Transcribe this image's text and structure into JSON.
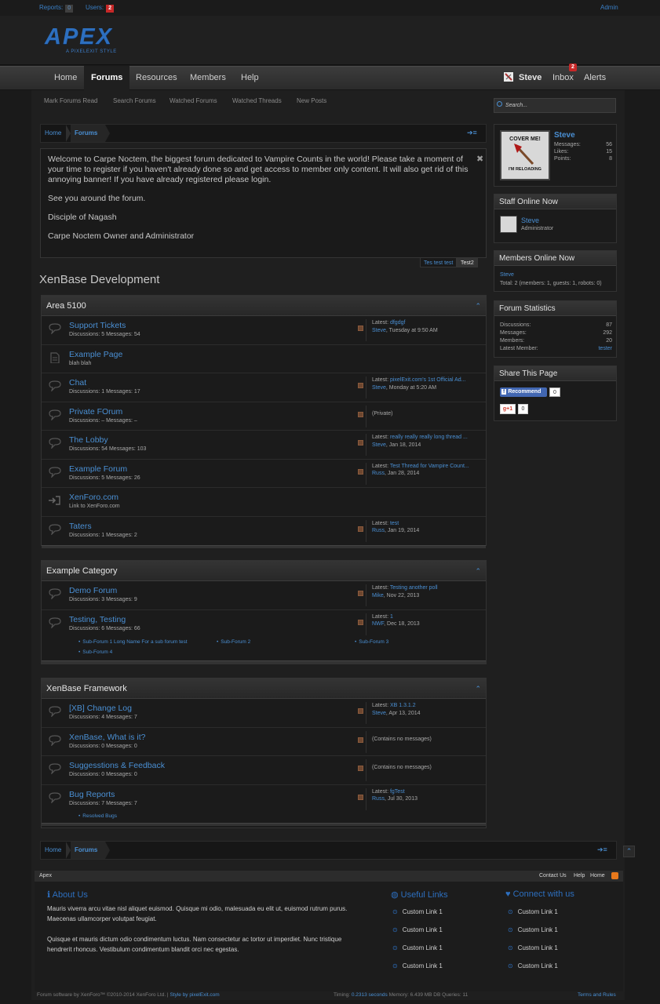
{
  "topbar": {
    "reports_label": "Reports:",
    "reports_count": "0",
    "users_label": "Users:",
    "users_count": "2",
    "admin": "Admin"
  },
  "header": {
    "logo": "APEX",
    "logo_sub": "A PIXELEXIT STYLE"
  },
  "nav": {
    "tabs": [
      "Home",
      "Forums",
      "Resources",
      "Members",
      "Help"
    ],
    "user": "Steve",
    "inbox": "Inbox",
    "inbox_count": "2",
    "alerts": "Alerts"
  },
  "subnav": [
    "Mark Forums Read",
    "Search Forums",
    "Watched Forums",
    "Watched Threads",
    "New Posts"
  ],
  "search_placeholder": "Search...",
  "breadcrumb": {
    "home": "Home",
    "current": "Forums"
  },
  "notice": {
    "p1": "Welcome to Carpe Noctem, the biggest forum dedicated to Vampire Counts in the world! Please take a moment of your time to register if you haven't already done so and get access to member only content. It will also get rid of this annoying banner! If you have already registered please login.",
    "p2": "See you around the forum.",
    "p3": "Disciple of Nagash",
    "p4": "Carpe Noctem Owner and Administrator",
    "tabs": [
      "Tes test test",
      "Test2"
    ]
  },
  "section_title": "XenBase Development",
  "categories": [
    {
      "title": "Area 5100",
      "nodes": [
        {
          "title": "Support Tickets",
          "meta": "Discussions: 5  Messages: 54",
          "lp1": "Latest: ",
          "lp_title": "dfgdgf",
          "lp2": "Steve",
          "lp_date": ", Tuesday at 9:50 AM"
        },
        {
          "title": "Example Page",
          "meta": "blah blah"
        },
        {
          "title": "Chat",
          "meta": "Discussions: 1  Messages: 17",
          "lp1": "Latest: ",
          "lp_title": "pixelExit.com's 1st Official Ad...",
          "lp2": "Steve",
          "lp_date": ", Monday at 5:20 AM"
        },
        {
          "title": "Private FOrum",
          "meta": "Discussions: –  Messages: –",
          "status": "(Private)"
        },
        {
          "title": "The Lobby",
          "meta": "Discussions: 54  Messages: 103",
          "lp1": "Latest: ",
          "lp_title": "really really really long thread ...",
          "lp2": "Steve",
          "lp_date": ", Jan 18, 2014"
        },
        {
          "title": "Example Forum",
          "meta": "Discussions: 5  Messages: 26",
          "lp1": "Latest: ",
          "lp_title": "Test Thread for Vampire Count...",
          "lp2": "Russ",
          "lp_date": ", Jan 28, 2014"
        },
        {
          "title": "XenForo.com",
          "meta": "Link to XenForo.com"
        },
        {
          "title": "Taters",
          "meta": "Discussions: 1  Messages: 2",
          "lp1": "Latest: ",
          "lp_title": "test",
          "lp2": "Russ",
          "lp_date": ", Jan 19, 2014"
        }
      ]
    },
    {
      "title": "Example Category",
      "nodes": [
        {
          "title": "Demo Forum",
          "meta": "Discussions: 3  Messages: 9",
          "lp1": "Latest: ",
          "lp_title": "Testing another poll",
          "lp2": "Mike",
          "lp_date": ", Nov 22, 2013"
        },
        {
          "title": "Testing, Testing",
          "meta": "Discussions: 6  Messages: 66",
          "lp1": "Latest: ",
          "lp_title": "1",
          "lp2": "NWF",
          "lp_date": ", Dec 18, 2013",
          "subforums": [
            "Sub-Forum 1 Long Name For a sub forum test",
            "Sub-Forum 2",
            "Sub-Forum 3",
            "Sub-Forum 4"
          ]
        }
      ]
    },
    {
      "title": "XenBase Framework",
      "nodes": [
        {
          "title": "[XB] Change Log",
          "meta": "Discussions: 4  Messages: 7",
          "lp1": "Latest: ",
          "lp_title": "XB 1.3.1.2",
          "lp2": "Steve",
          "lp_date": ", Apr 13, 2014"
        },
        {
          "title": "XenBase, What is it?",
          "meta": "Discussions: 0  Messages: 0",
          "status": "(Contains no messages)"
        },
        {
          "title": "Suggesstions & Feedback",
          "meta": "Discussions: 0  Messages: 0",
          "status": "(Contains no messages)"
        },
        {
          "title": "Bug Reports",
          "meta": "Discussions: 7  Messages: 7",
          "lp1": "Latest: ",
          "lp_title": "fgTest",
          "lp2": "Russ",
          "lp_date": ", Jul 30, 2013",
          "subforums": [
            "Resolved Bugs"
          ]
        }
      ]
    }
  ],
  "sidebar": {
    "visitor": {
      "name": "Steve",
      "avatar_text": "COVER ME!",
      "avatar_text2": "I'M RELOADING",
      "rows": [
        [
          "Messages:",
          "56"
        ],
        [
          "Likes:",
          "15"
        ],
        [
          "Points:",
          "8"
        ]
      ]
    },
    "staff": {
      "title": "Staff Online Now",
      "name": "Steve",
      "role": "Administrator"
    },
    "members": {
      "title": "Members Online Now",
      "name": "Steve",
      "total": "Total: 2 (members: 1, guests: 1, robots: 0)"
    },
    "stats": {
      "title": "Forum Statistics",
      "rows": [
        [
          "Discussions:",
          "87"
        ],
        [
          "Messages:",
          "292"
        ],
        [
          "Members:",
          "20"
        ],
        [
          "Latest Member:",
          "tester"
        ]
      ]
    },
    "share": {
      "title": "Share This Page",
      "recommend": "Recommend",
      "recommend_count": "0",
      "gplus": "+1",
      "gplus_count": "0"
    }
  },
  "footer_bar": {
    "brand": "Apex",
    "links": [
      "Contact Us",
      "Help",
      "Home"
    ]
  },
  "footer": {
    "about_title": "About Us",
    "about_p1": "Mauris viverra arcu vitae nisl aliquet euismod. Quisque mi odio, malesuada eu elit ut, euismod rutrum purus. Maecenas ullamcorper volutpat feugiat.",
    "about_p2": "Quisque et mauris dictum odio condimentum luctus. Nam consectetur ac tortor ut imperdiet. Nunc tristique hendrerit rhoncus. Vestibulum condimentum blandit orci nec egestas.",
    "useful_title": "Useful Links",
    "connect_title": "Connect with us",
    "link_label": "Custom Link 1"
  },
  "copyright": {
    "left": "Forum software by XenForo™ ©2010-2014 XenForo Ltd. | ",
    "style": "Style by pixelExit.com",
    "timing1": "Timing: ",
    "timing_val": "0.2313 seconds",
    "timing2": " Memory: 6.439 MB DB Queries: 11",
    "terms": "Terms and Rules"
  },
  "colors": {
    "accent": "#4a8fd3",
    "brand": "#2d6fbf",
    "badge": "#c82828",
    "background": "#1a1a1a"
  }
}
